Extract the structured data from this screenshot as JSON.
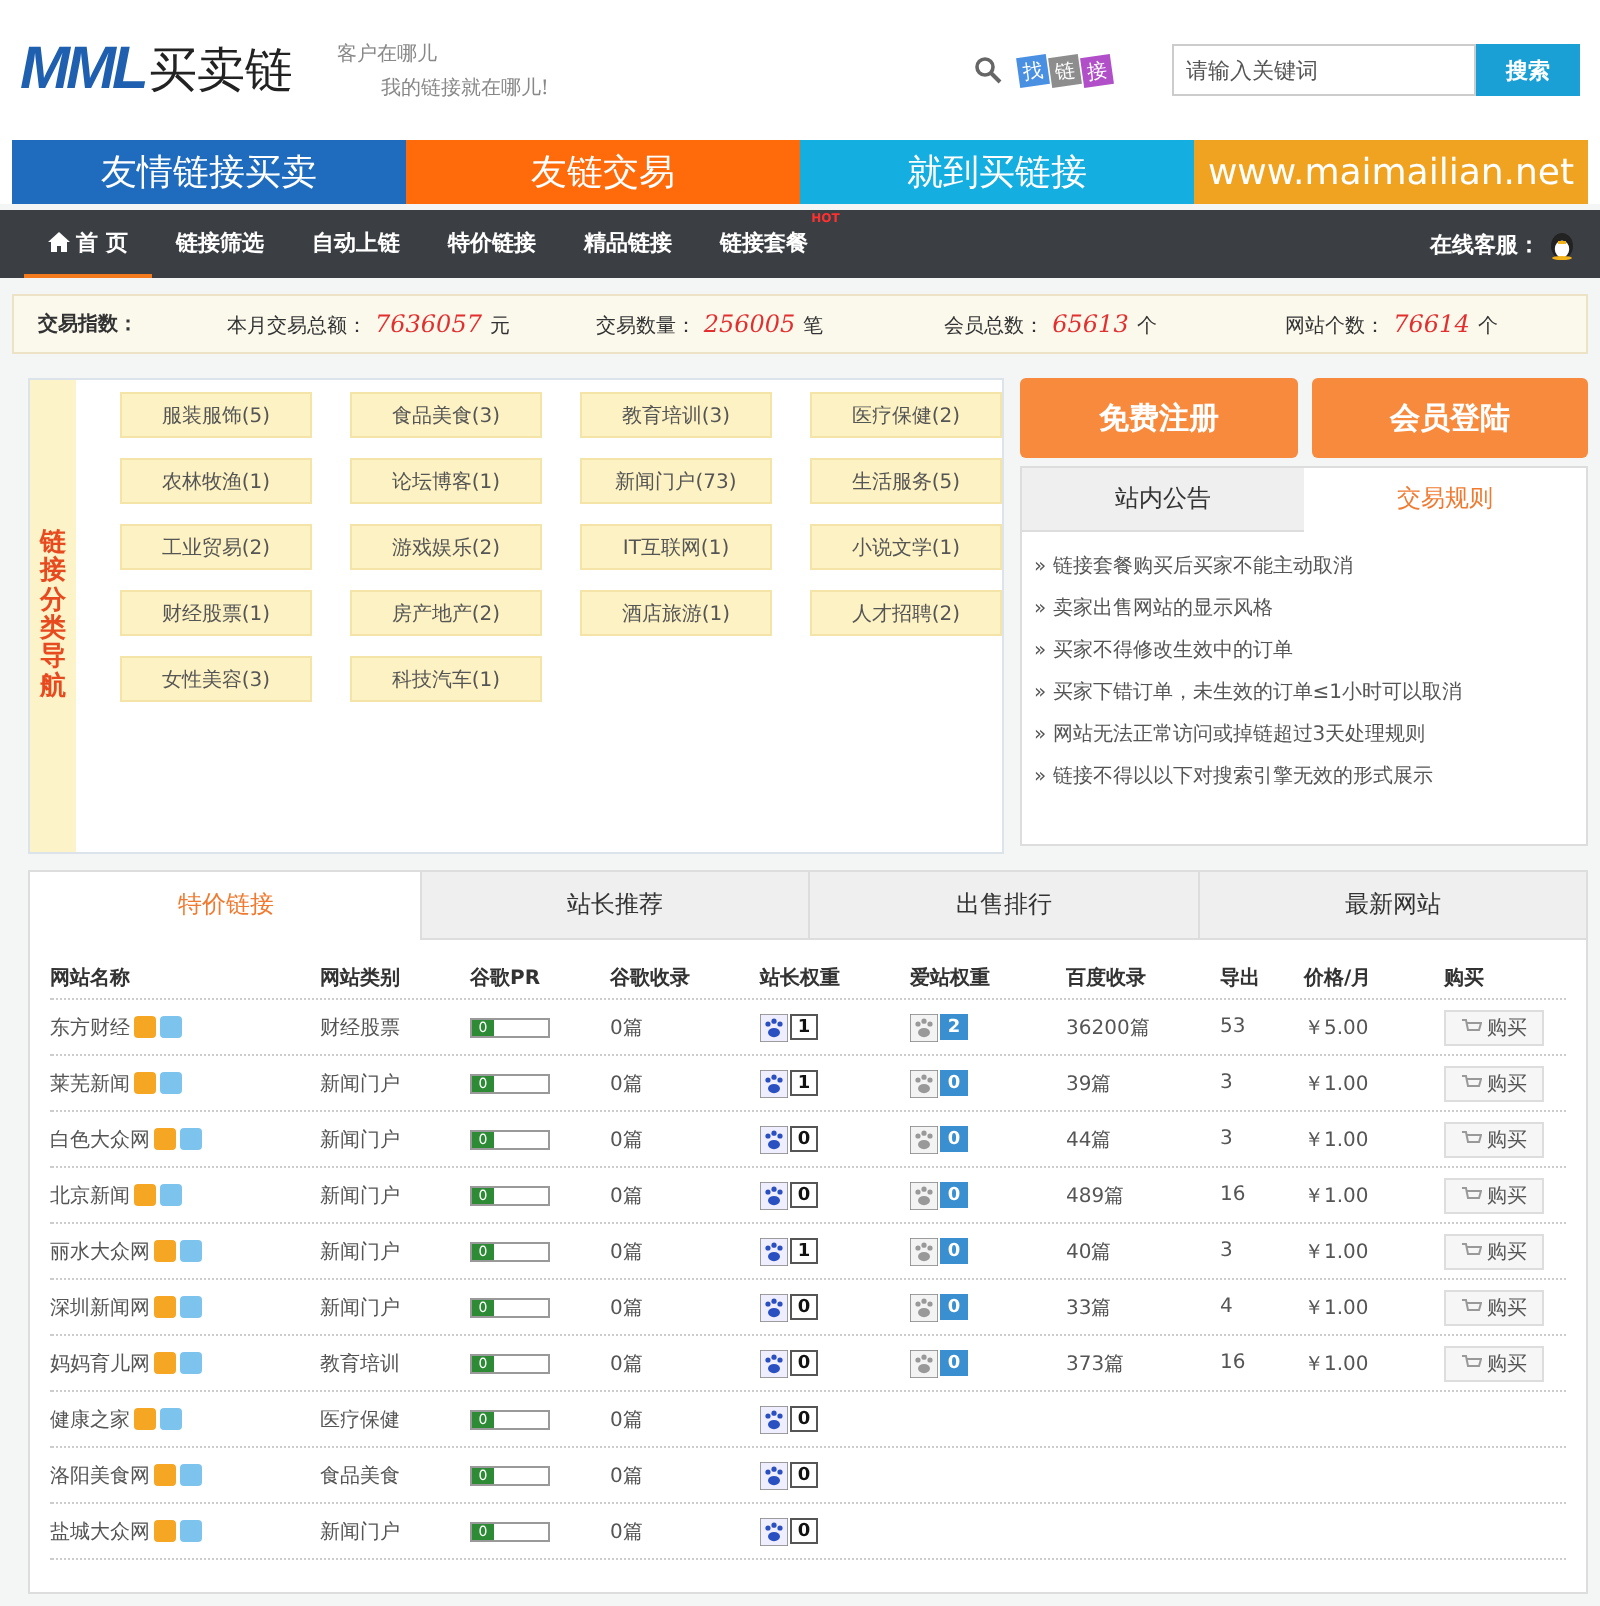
{
  "header": {
    "logo_mark": "MML",
    "logo_text": "买卖链",
    "slogan": [
      "客户在哪儿",
      "我的链接就在哪儿!"
    ],
    "find_logo": [
      "找",
      "链",
      "接"
    ],
    "search": {
      "placeholder": "请输入关键词",
      "button": "搜索"
    }
  },
  "banner": [
    {
      "text": "友情链接买卖",
      "color": "#1f6cbf"
    },
    {
      "text": "友链交易",
      "color": "#ff6a0a"
    },
    {
      "text": "就到买链接",
      "color": "#14aee0"
    },
    {
      "text": "www.maimailian.net",
      "color": "#f0a321"
    }
  ],
  "nav": {
    "items": [
      {
        "label": "首 页",
        "selected": true,
        "home": true
      },
      {
        "label": "链接筛选",
        "selected": false
      },
      {
        "label": "自动上链",
        "selected": false
      },
      {
        "label": "特价链接",
        "selected": false
      },
      {
        "label": "精品链接",
        "selected": false
      },
      {
        "label": "链接套餐",
        "selected": false,
        "badge": "HOT"
      }
    ],
    "service": "在线客服："
  },
  "stats": {
    "label": "交易指数：",
    "items": [
      {
        "label": "本月交易总额：",
        "value": "7636057",
        "unit": "元"
      },
      {
        "label": "交易数量：",
        "value": "256005",
        "unit": "笔"
      },
      {
        "label": "会员总数：",
        "value": "65613",
        "unit": "个"
      },
      {
        "label": "网站个数：",
        "value": "76614",
        "unit": "个"
      }
    ]
  },
  "categories": {
    "title": "链接分类导航",
    "items": [
      "服装服饰(5)",
      "食品美食(3)",
      "教育培训(3)",
      "医疗保健(2)",
      "农林牧渔(1)",
      "论坛博客(1)",
      "新闻门户(73)",
      "生活服务(5)",
      "工业贸易(2)",
      "游戏娱乐(2)",
      "IT互联网(1)",
      "小说文学(1)",
      "财经股票(1)",
      "房产地产(2)",
      "酒店旅游(1)",
      "人才招聘(2)",
      "女性美容(3)",
      "科技汽车(1)"
    ]
  },
  "account_buttons": [
    "免费注册",
    "会员登陆"
  ],
  "notice": {
    "tabs": [
      {
        "label": "站内公告",
        "selected": false
      },
      {
        "label": "交易规则",
        "selected": true
      }
    ],
    "items": [
      "» 链接套餐购买后买家不能主动取消",
      "» 卖家出售网站的显示风格",
      "» 买家不得修改生效中的订单",
      "» 买家下错订单，未生效的订单≤1小时可以取消",
      "» 网站无法正常访问或掉链超过3天处理规则",
      "» 链接不得以以下对搜索引擎无效的形式展示"
    ]
  },
  "listing": {
    "tabs": [
      {
        "label": "特价链接",
        "selected": true
      },
      {
        "label": "站长推荐",
        "selected": false
      },
      {
        "label": "出售排行",
        "selected": false
      },
      {
        "label": "最新网站",
        "selected": false
      }
    ],
    "columns": [
      "网站名称",
      "网站类别",
      "谷歌PR",
      "谷歌收录",
      "站长权重",
      "爱站权重",
      "百度收录",
      "导出",
      "价格/月",
      "购买"
    ],
    "rows": [
      {
        "name": "东方财经",
        "category": "财经股票",
        "pr": "0",
        "google": "0篇",
        "zz": "1",
        "az": "2",
        "baidu": "36200篇",
        "out": "53",
        "price": "￥5.00",
        "buy": "购买"
      },
      {
        "name": "莱芜新闻",
        "category": "新闻门户",
        "pr": "0",
        "google": "0篇",
        "zz": "1",
        "az": "0",
        "baidu": "39篇",
        "out": "3",
        "price": "￥1.00",
        "buy": "购买"
      },
      {
        "name": "白色大众网",
        "category": "新闻门户",
        "pr": "0",
        "google": "0篇",
        "zz": "0",
        "az": "0",
        "baidu": "44篇",
        "out": "3",
        "price": "￥1.00",
        "buy": "购买"
      },
      {
        "name": "北京新闻",
        "category": "新闻门户",
        "pr": "0",
        "google": "0篇",
        "zz": "0",
        "az": "0",
        "baidu": "489篇",
        "out": "16",
        "price": "￥1.00",
        "buy": "购买"
      },
      {
        "name": "丽水大众网",
        "category": "新闻门户",
        "pr": "0",
        "google": "0篇",
        "zz": "1",
        "az": "0",
        "baidu": "40篇",
        "out": "3",
        "price": "￥1.00",
        "buy": "购买"
      },
      {
        "name": "深圳新闻网",
        "category": "新闻门户",
        "pr": "0",
        "google": "0篇",
        "zz": "0",
        "az": "0",
        "baidu": "33篇",
        "out": "4",
        "price": "￥1.00",
        "buy": "购买"
      },
      {
        "name": "妈妈育儿网",
        "category": "教育培训",
        "pr": "0",
        "google": "0篇",
        "zz": "0",
        "az": "0",
        "baidu": "373篇",
        "out": "16",
        "price": "￥1.00",
        "buy": "购买"
      },
      {
        "name": "健康之家",
        "category": "医疗保健",
        "pr": "0",
        "google": "0篇",
        "zz": "0"
      },
      {
        "name": "洛阳美食网",
        "category": "食品美食",
        "pr": "0",
        "google": "0篇",
        "zz": "0"
      },
      {
        "name": "盐城大众网",
        "category": "新闻门户",
        "pr": "0",
        "google": "0篇",
        "zz": "0"
      }
    ]
  }
}
